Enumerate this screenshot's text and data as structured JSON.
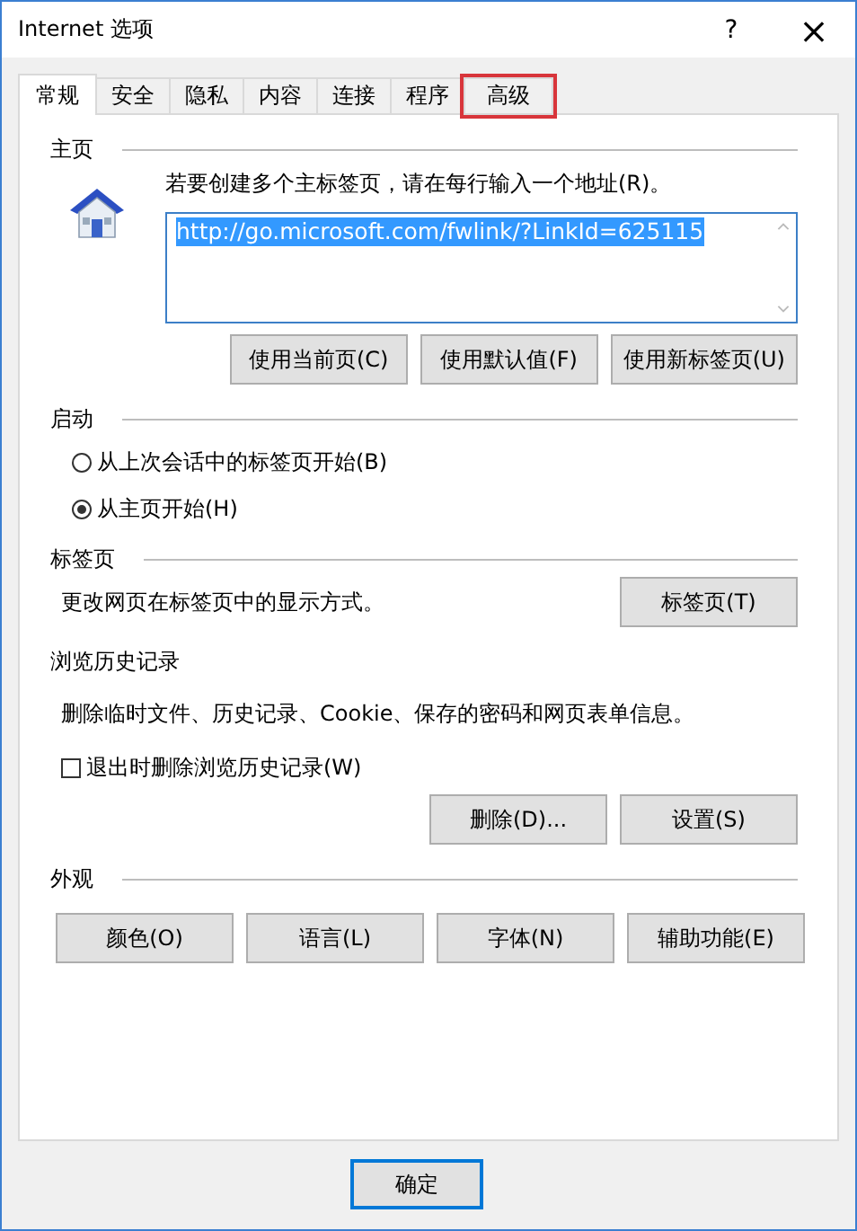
{
  "window": {
    "title": "Internet 选项",
    "help": "?",
    "close": "×"
  },
  "tabs": [
    {
      "label": "常规",
      "selected": true,
      "highlighted": false
    },
    {
      "label": "安全",
      "selected": false,
      "highlighted": false
    },
    {
      "label": "隐私",
      "selected": false,
      "highlighted": false
    },
    {
      "label": "内容",
      "selected": false,
      "highlighted": false
    },
    {
      "label": "连接",
      "selected": false,
      "highlighted": false
    },
    {
      "label": "程序",
      "selected": false,
      "highlighted": false
    },
    {
      "label": "高级",
      "selected": false,
      "highlighted": true
    }
  ],
  "home": {
    "heading": "主页",
    "hint": "若要创建多个主标签页，请在每行输入一个地址(R)。",
    "value": "http://go.microsoft.com/fwlink/?LinkId=625115",
    "buttons": [
      "使用当前页(C)",
      "使用默认值(F)",
      "使用新标签页(U)"
    ]
  },
  "startup": {
    "heading": "启动",
    "options": [
      {
        "label": "从上次会话中的标签页开始(B)",
        "selected": false
      },
      {
        "label": "从主页开始(H)",
        "selected": true
      }
    ]
  },
  "tabs_section": {
    "heading": "标签页",
    "text": "更改网页在标签页中的显示方式。",
    "button": "标签页(T)"
  },
  "history": {
    "heading": "浏览历史记录",
    "text": "删除临时文件、历史记录、Cookie、保存的密码和网页表单信息。",
    "checkbox": {
      "label": "退出时删除浏览历史记录(W)",
      "checked": false
    },
    "buttons": [
      "删除(D)...",
      "设置(S)"
    ]
  },
  "appearance": {
    "heading": "外观",
    "buttons": [
      "颜色(O)",
      "语言(L)",
      "字体(N)",
      "辅助功能(E)"
    ]
  },
  "footer_buttons": [
    {
      "label": "确定",
      "default": true
    }
  ]
}
